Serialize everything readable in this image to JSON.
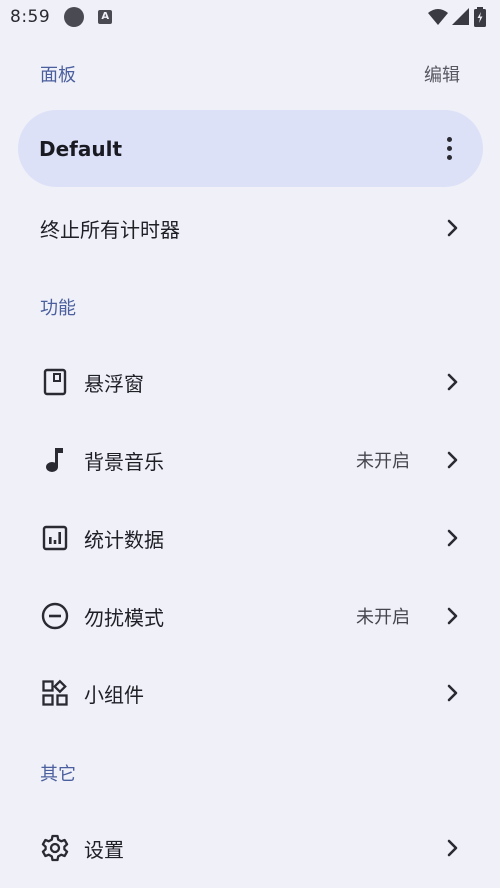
{
  "status": {
    "time": "8:59",
    "badge": "A"
  },
  "panel": {
    "header": "面板",
    "edit_label": "编辑",
    "card_title": "Default",
    "stop_all": "终止所有计时器"
  },
  "features": {
    "header": "功能",
    "items": [
      {
        "label": "悬浮窗",
        "icon": "floating-window-icon",
        "value": ""
      },
      {
        "label": "背景音乐",
        "icon": "music-note-icon",
        "value": "未开启"
      },
      {
        "label": "统计数据",
        "icon": "statistics-icon",
        "value": ""
      },
      {
        "label": "勿扰模式",
        "icon": "do-not-disturb-icon",
        "value": "未开启"
      },
      {
        "label": "小组件",
        "icon": "widgets-icon",
        "value": ""
      }
    ]
  },
  "other": {
    "header": "其它",
    "settings_label": "设置"
  },
  "colors": {
    "background": "#eff0f8",
    "accent_header": "#4b5f9e",
    "card": "#dde1f7"
  }
}
